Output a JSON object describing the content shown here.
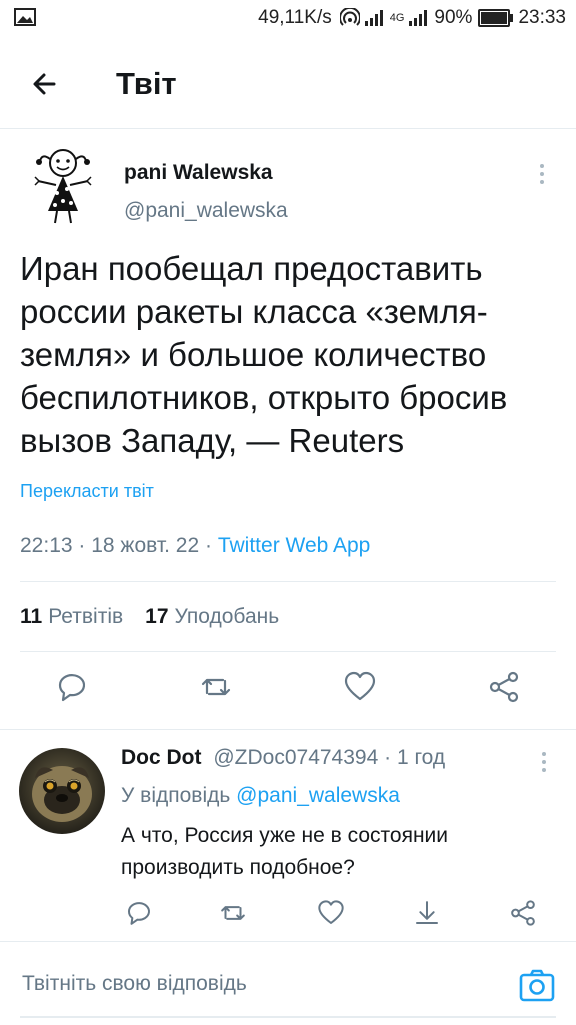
{
  "status_bar": {
    "network_speed": "49,11K/s",
    "signal_label": "4G",
    "battery": "90%",
    "battery_level": 0.9,
    "time": "23:33"
  },
  "app_bar": {
    "title": "Твіт"
  },
  "tweet": {
    "author_name": "pani Walewska",
    "author_handle": "@pani_walewska",
    "text": "Иран пообещал предоставить россии ракеты класса «земля-земля» и большое количество беспилотников, открыто бросив вызов Западу, — Reuters",
    "translate_label": "Перекласти твіт",
    "time": "22:13",
    "date": "18 жовт. 22",
    "source": "Twitter Web App",
    "retweets_count": "11",
    "retweets_label": "Ретвітів",
    "likes_count": "17",
    "likes_label": "Уподобань"
  },
  "reply": {
    "author_name": "Doc Dot",
    "author_handle": "@ZDoc07474394",
    "time_ago": "1 год",
    "replying_to_label": "У відповідь",
    "replying_to_handle": "@pani_walewska",
    "text": "А что, Россия уже не в состоянии производить подобное?"
  },
  "compose": {
    "placeholder": "Твітніть свою відповідь"
  },
  "colors": {
    "accent": "#1da1f2",
    "secondary_text": "#657786",
    "primary_text": "#14171a",
    "divider": "#e6ecf0"
  }
}
